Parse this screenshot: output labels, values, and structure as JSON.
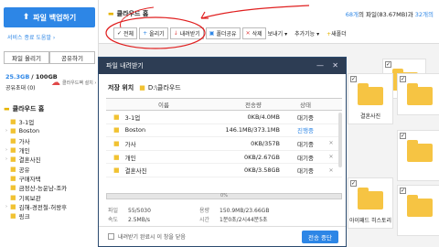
{
  "sidebar": {
    "backup_button": "파일 백업하기",
    "guide_link": "서비스 종료 도움말 ›",
    "tabs": [
      "파일 올리기",
      "공유하기"
    ],
    "quota_used": "25.3GB",
    "quota_total": "/ 100GB",
    "quota_free_label": "공유초대 (0)",
    "cloud_text": "클라우드팩 설치 ›",
    "tree_root": "클라우드 홈",
    "tree": [
      "3-1업",
      "Boston",
      "가사",
      "개인",
      "결혼사진",
      "공유",
      "구매자택",
      "금정산-능운남-조카",
      "기록보관",
      "김해-경전철-허왕후",
      "링크"
    ]
  },
  "topbar": {
    "crumb": "클라우드 홈",
    "summary_files": "68개",
    "summary_mid": "의 파일(83.67MB)과",
    "summary_folders": "32개의"
  },
  "toolbar": {
    "all": "전체",
    "upload": "올리기",
    "download": "내려받기",
    "share": "폴더공유",
    "delete": "삭제",
    "view": "보내기 ▾",
    "more": "추가기능 ▾",
    "new": "새폴더"
  },
  "cards": [
    "",
    "",
    "결혼사진",
    "",
    "아이패드 히스토리"
  ],
  "dialog": {
    "title": "파일 내려받기",
    "save_label": "저장 위치",
    "save_path": "D:\\클라우드",
    "headers": {
      "name": "이름",
      "size": "전송량",
      "status": "상태"
    },
    "rows": [
      {
        "name": "3-1업",
        "size": "0KB/4.0MB",
        "status": "대기중"
      },
      {
        "name": "Boston",
        "size": "146.1MB/373.1MB",
        "status": "진행중"
      },
      {
        "name": "가사",
        "size": "0KB/357B",
        "status": "대기중"
      },
      {
        "name": "개인",
        "size": "0KB/2.67GB",
        "status": "대기중"
      },
      {
        "name": "결혼사진",
        "size": "0KB/3.58GB",
        "status": "대기중"
      }
    ],
    "progress_text": "0%",
    "progress": 0.0,
    "stats": {
      "file_label": "파일",
      "file_value": "55/5030",
      "speed_label": "속도",
      "speed_value": "2.5MB/s",
      "total_label": "용량",
      "total_value": "150.9MB/23.66GB",
      "time_label": "시간",
      "time_value": "1분0초/2시44분5초"
    },
    "close_after": "내려받기 완료시 이 창을 닫음",
    "stop_button": "전송 중단"
  }
}
